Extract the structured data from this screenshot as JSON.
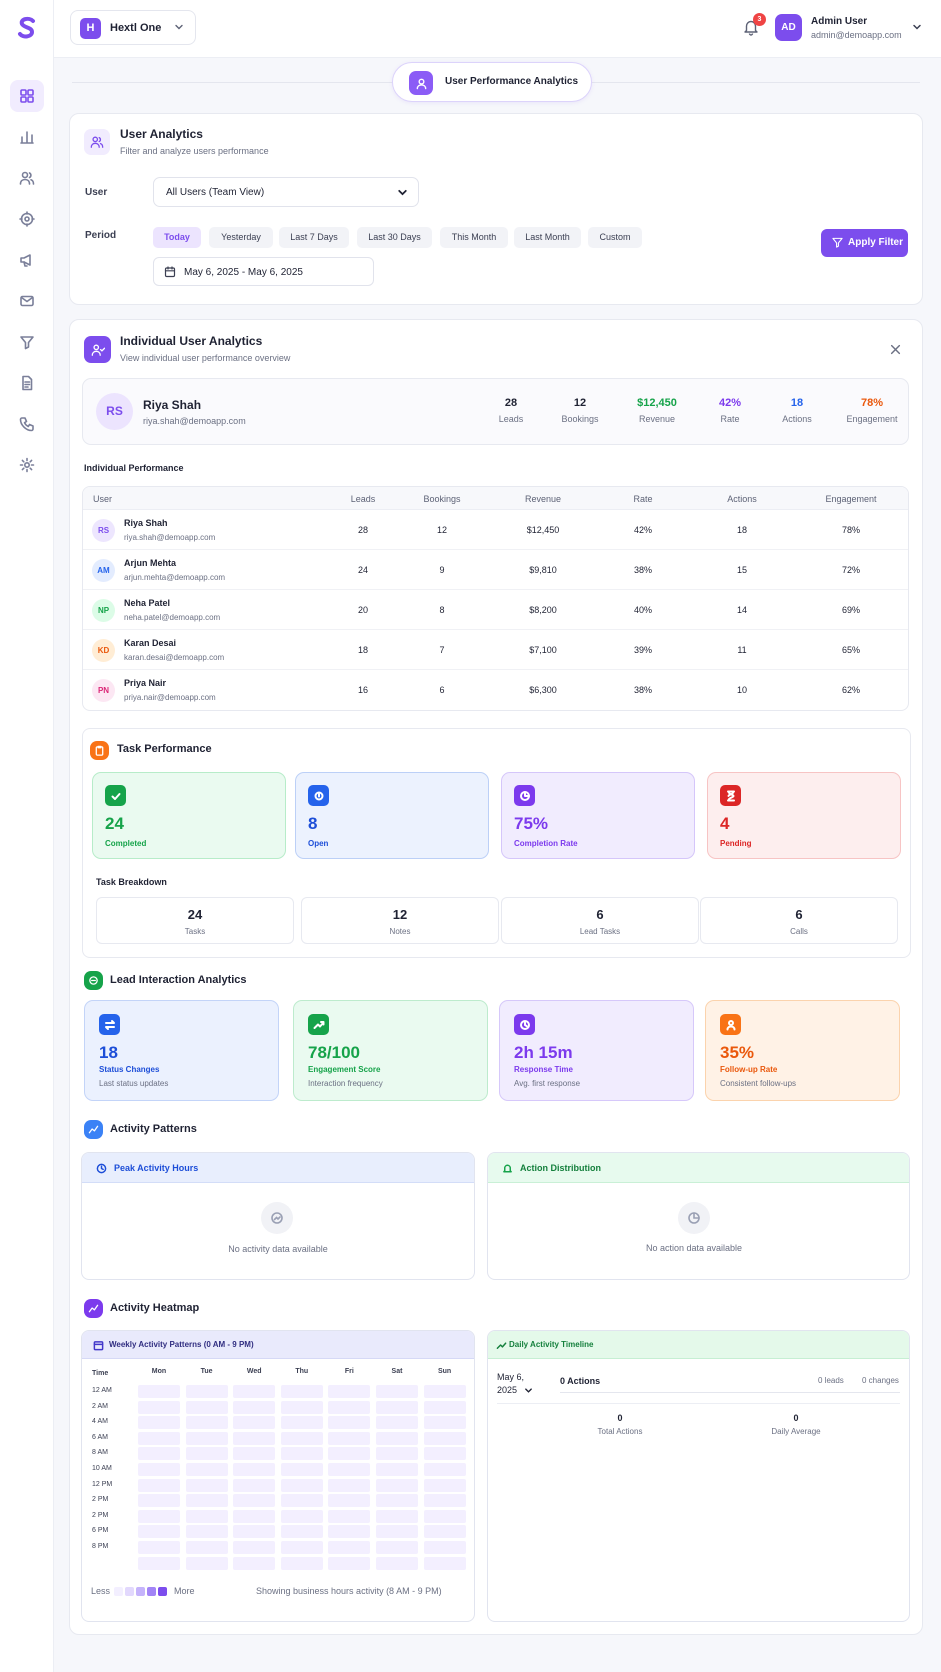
{
  "org": {
    "initial": "H",
    "name": "Hextl One"
  },
  "header": {
    "notifications": "3",
    "user_initials": "AD",
    "user_name": "Admin User",
    "user_email": "admin@demoapp.com"
  },
  "page_title": "User Performance Analytics",
  "filters": {
    "title": "User Analytics",
    "subtitle": "Filter and analyze users performance",
    "user_label": "User",
    "user_value": "All Users (Team View)",
    "period_label": "Period",
    "periods": [
      "Today",
      "Yesterday",
      "Last 7 Days",
      "Last 30 Days",
      "This Month",
      "Last Month",
      "Custom"
    ],
    "active_period": "Today",
    "date_range": "May 6, 2025 - May 6, 2025",
    "apply_label": "Apply Filter"
  },
  "individual": {
    "title": "Individual User Analytics",
    "subtitle": "View individual user performance overview",
    "user": {
      "initials": "RS",
      "name": "Riya Shah",
      "email": "riya.shah@demoapp.com"
    },
    "stats": [
      {
        "value": "28",
        "label": "Leads",
        "color": "#1f2233"
      },
      {
        "value": "12",
        "label": "Bookings",
        "color": "#1f2233"
      },
      {
        "value": "$12,450",
        "label": "Revenue",
        "color": "#16a34a"
      },
      {
        "value": "42%",
        "label": "Rate",
        "color": "#7c3aed"
      },
      {
        "value": "18",
        "label": "Actions",
        "color": "#2563eb"
      },
      {
        "value": "78%",
        "label": "Engagement",
        "color": "#ea580c"
      }
    ]
  },
  "performance": {
    "title": "Individual Performance",
    "columns": [
      "User",
      "Leads",
      "Bookings",
      "Revenue",
      "Rate",
      "Actions",
      "Engagement"
    ],
    "rows": [
      {
        "initials": "RS",
        "name": "Riya Shah",
        "email": "riya.shah@demoapp.com",
        "leads": "28",
        "bookings": "12",
        "revenue": "$12,450",
        "rate": "42%",
        "actions": "18",
        "engagement": "78%"
      },
      {
        "initials": "AM",
        "name": "Arjun Mehta",
        "email": "arjun.mehta@demoapp.com",
        "leads": "24",
        "bookings": "9",
        "revenue": "$9,810",
        "rate": "38%",
        "actions": "15",
        "engagement": "72%"
      },
      {
        "initials": "NP",
        "name": "Neha Patel",
        "email": "neha.patel@demoapp.com",
        "leads": "20",
        "bookings": "8",
        "revenue": "$8,200",
        "rate": "40%",
        "actions": "14",
        "engagement": "69%"
      },
      {
        "initials": "KD",
        "name": "Karan Desai",
        "email": "karan.desai@demoapp.com",
        "leads": "18",
        "bookings": "7",
        "revenue": "$7,100",
        "rate": "39%",
        "actions": "11",
        "engagement": "65%"
      },
      {
        "initials": "PN",
        "name": "Priya Nair",
        "email": "priya.nair@demoapp.com",
        "leads": "16",
        "bookings": "6",
        "revenue": "$6,300",
        "rate": "38%",
        "actions": "10",
        "engagement": "62%"
      }
    ]
  },
  "tasks": {
    "title": "Task Performance",
    "cards": [
      {
        "value": "24",
        "label": "Completed",
        "icon": "check-icon"
      },
      {
        "value": "8",
        "label": "Open",
        "icon": "open-icon"
      },
      {
        "value": "75%",
        "label": "Completion Rate",
        "icon": "pie-icon"
      },
      {
        "value": "4",
        "label": "Pending",
        "icon": "hourglass-icon"
      }
    ],
    "breakdown_title": "Task Breakdown",
    "breakdown": [
      {
        "value": "24",
        "label": "Tasks"
      },
      {
        "value": "12",
        "label": "Notes"
      },
      {
        "value": "6",
        "label": "Lead Tasks"
      },
      {
        "value": "6",
        "label": "Calls"
      }
    ]
  },
  "lead": {
    "title": "Lead Interaction Analytics",
    "cards": [
      {
        "value": "18",
        "label": "Status Changes",
        "sub": "Last status updates"
      },
      {
        "value": "78/100",
        "label": "Engagement Score",
        "sub": "Interaction frequency"
      },
      {
        "value": "2h 15m",
        "label": "Response Time",
        "sub": "Avg. first response"
      },
      {
        "value": "35%",
        "label": "Follow-up Rate",
        "sub": "Consistent follow-ups"
      }
    ]
  },
  "patterns": {
    "title": "Activity Patterns",
    "peak_title": "Peak Activity Hours",
    "peak_empty": "No activity data available",
    "dist_title": "Action Distribution",
    "dist_empty": "No action data available"
  },
  "heatmap": {
    "title": "Activity Heatmap",
    "weekly_title": "Weekly Activity Patterns (0 AM - 9 PM)",
    "time_label": "Time",
    "days": [
      "Mon",
      "Tue",
      "Wed",
      "Thu",
      "Fri",
      "Sat",
      "Sun"
    ],
    "times": [
      "12 AM",
      "2 AM",
      "4 AM",
      "6 AM",
      "8 AM",
      "10 AM",
      "12 PM",
      "2 PM",
      "2 PM",
      "6 PM",
      "8 PM",
      ""
    ],
    "less": "Less",
    "more": "More",
    "footnote": "Showing business hours activity (8 AM - 9 PM)"
  },
  "timeline": {
    "title": "Daily Activity Timeline",
    "date_line1": "May 6,",
    "date_line2": "2025",
    "actions": "0 Actions",
    "leads": "0 leads",
    "changes": "0 changes",
    "total_value": "0",
    "total_label": "Total Actions",
    "avg_value": "0",
    "avg_label": "Daily Average"
  }
}
